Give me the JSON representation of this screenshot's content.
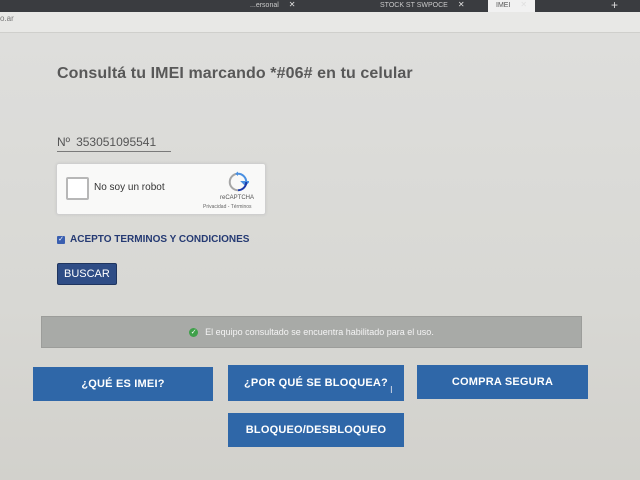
{
  "browser": {
    "tabs": [
      {
        "label": "...ersonal"
      },
      {
        "label": "STOCK ST SWPOCE"
      },
      {
        "label": "IMEI"
      }
    ],
    "new_tab_symbol": "+",
    "url_fragment": "o.ar"
  },
  "page": {
    "title": "Consultá tu IMEI marcando *#06# en tu celular",
    "imei_prefix": "Nº",
    "imei_value": "353051095541",
    "captcha": {
      "label": "No soy un robot",
      "brand": "reCAPTCHA",
      "links": "Privacidad - Términos"
    },
    "terms_label": "ACEPTO TERMINOS Y CONDICIONES",
    "search_button": "BUSCAR",
    "status_message": "El equipo consultado se encuentra habilitado para el uso.",
    "nav_buttons": [
      {
        "label": "¿QUÉ ES IMEI?"
      },
      {
        "label": "¿POR QUÉ SE BLOQUEA?"
      },
      {
        "label": "COMPRA SEGURA"
      },
      {
        "label": "BLOQUEO/DESBLOQUEO"
      }
    ]
  },
  "colors": {
    "accent_blue": "#2f67a8",
    "dark_blue": "#2f4d86",
    "status_bg": "#a8aaa7",
    "success_green": "#3fa04a"
  },
  "icons": {
    "captcha_checkbox": "checkbox-empty-icon",
    "terms_checkbox": "checkbox-checked-icon",
    "status": "check-circle-icon",
    "recaptcha": "recaptcha-logo-icon",
    "cursor": "text-cursor-icon"
  }
}
